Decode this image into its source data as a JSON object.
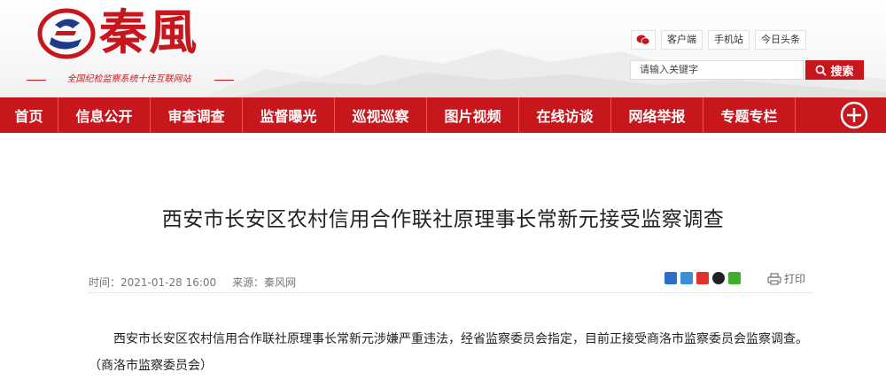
{
  "header": {
    "logo_text": "秦風",
    "slogan": "全国纪检监察系统十佳互联网站",
    "top_links": [
      "客户端",
      "手机站",
      "今日头条"
    ],
    "search_placeholder": "请输入关键字",
    "search_label": "搜索"
  },
  "nav": {
    "items": [
      "首页",
      "信息公开",
      "审查调查",
      "监督曝光",
      "巡视巡察",
      "图片视频",
      "在线访谈",
      "网络举报",
      "专题专栏"
    ]
  },
  "article": {
    "title": "西安市长安区农村信用合作联社原理事长常新元接受监察调查",
    "time_label": "时间：2021-01-28 16:00",
    "source_label": "来源：秦风网",
    "print_label": "打印",
    "body": "西安市长安区农村信用合作联社原理事长常新元涉嫌严重违法，经省监察委员会指定，目前正接受商洛市监察委员会监察调查。（商洛市监察委员会）"
  },
  "colors": {
    "brand_red": "#c8161d"
  }
}
